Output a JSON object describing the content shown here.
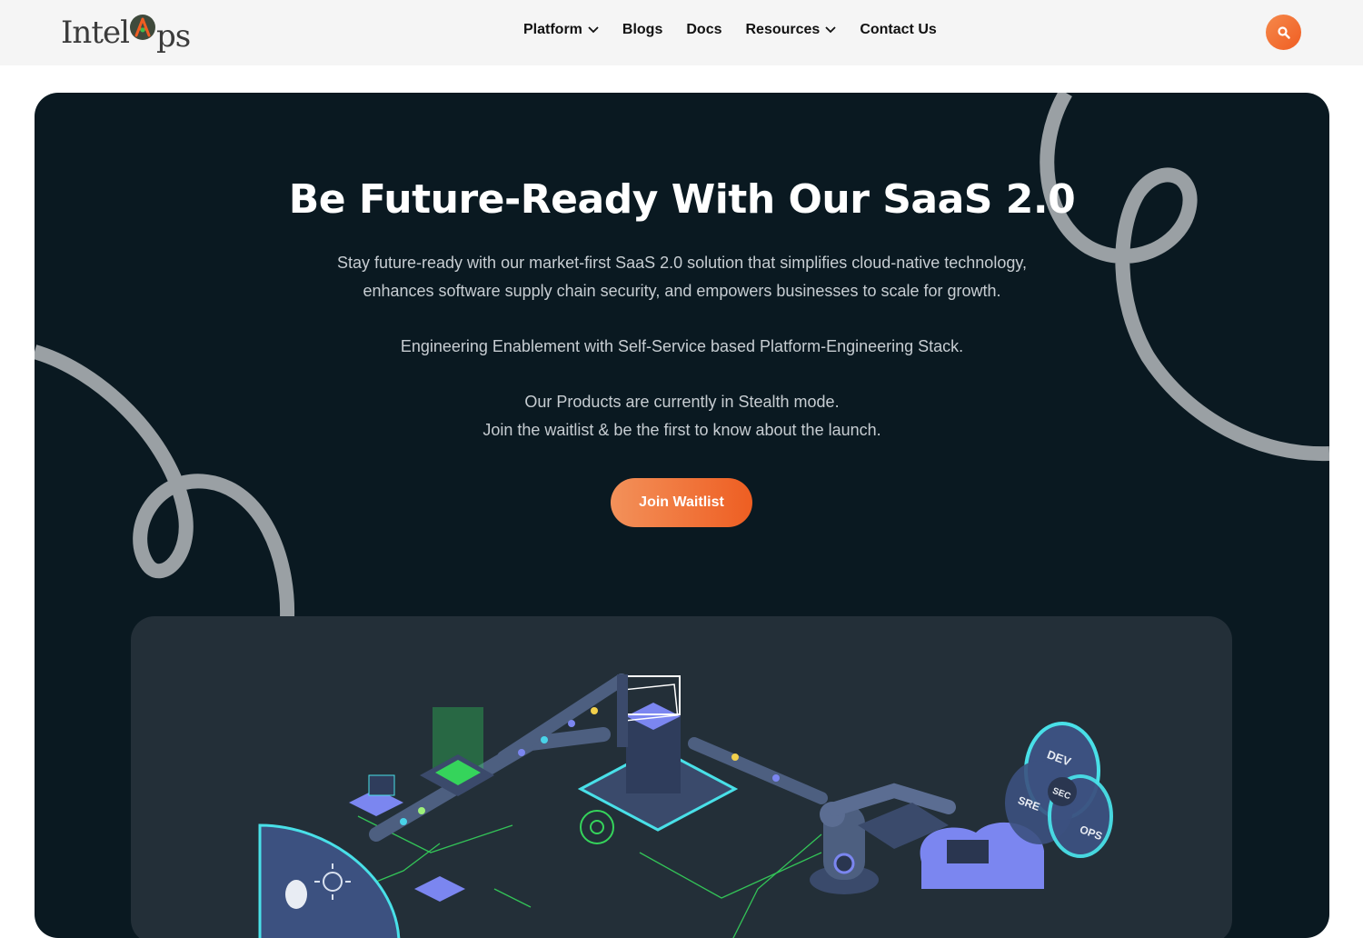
{
  "brand": {
    "name_left": "Intel",
    "name_right": "ps",
    "accent": "#f05d22"
  },
  "nav": {
    "items": [
      {
        "label": "Platform",
        "has_dropdown": true
      },
      {
        "label": "Blogs",
        "has_dropdown": false
      },
      {
        "label": "Docs",
        "has_dropdown": false
      },
      {
        "label": "Resources",
        "has_dropdown": true
      },
      {
        "label": "Contact Us",
        "has_dropdown": false
      }
    ],
    "search_icon": "search-icon"
  },
  "hero": {
    "title": "Be Future-Ready With Our SaaS 2.0",
    "paragraph1_line1": "Stay future-ready with our market-first SaaS 2.0 solution that simplifies cloud-native technology,",
    "paragraph1_line2": "enhances software supply chain security, and empowers businesses to scale for growth.",
    "paragraph2": "Engineering Enablement with Self-Service based Platform-Engineering Stack.",
    "paragraph3_line1": "Our Products are currently in Stealth mode.",
    "paragraph3_line2": "Join the waitlist & be the first to know about the launch.",
    "cta_label": "Join Waitlist",
    "background": "#0a1921"
  },
  "illustration": {
    "labels": {
      "dev": "DEV",
      "sec": "SEC",
      "sre": "SRE",
      "ops": "OPS"
    }
  }
}
